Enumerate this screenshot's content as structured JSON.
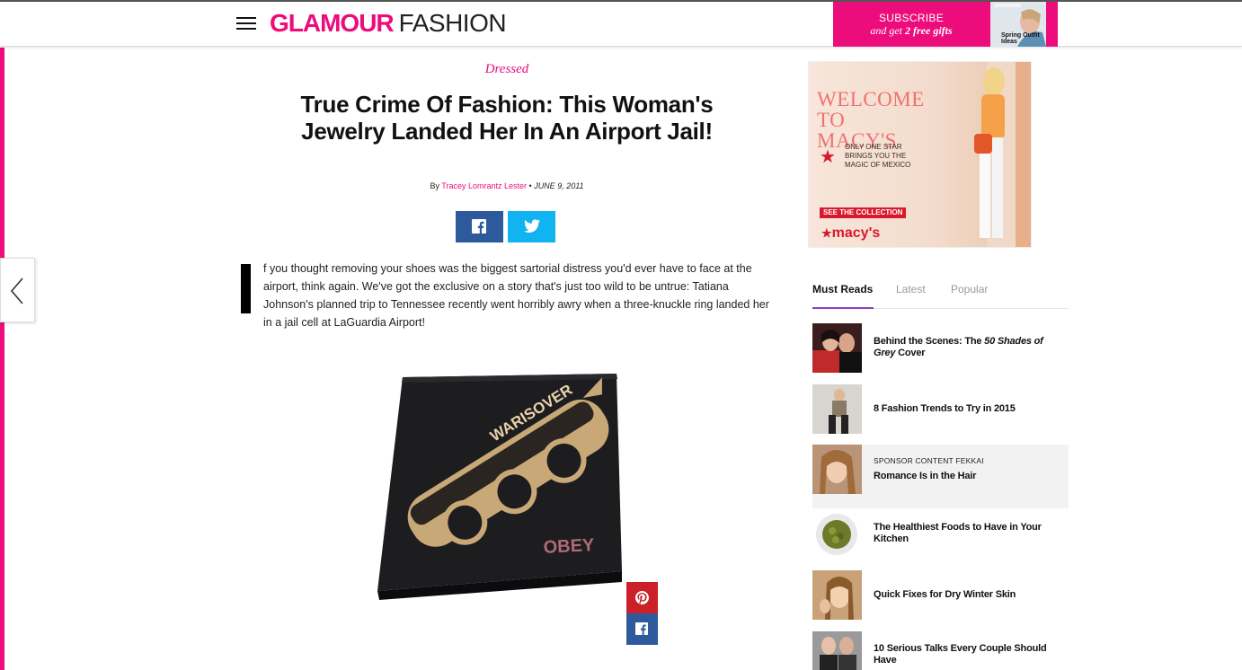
{
  "header": {
    "logo_glamour": "GLAMOUR",
    "logo_fashion": "FASHION",
    "subscribe_line1": "SUBSCRIBE",
    "subscribe_line2_a": "and get ",
    "subscribe_line2_b": "2 free gifts",
    "magazine_cover_text": "Spring Outfit Ideas"
  },
  "article": {
    "category": "Dressed",
    "title": "True Crime Of Fashion: This Woman's Jewelry Landed Her In An Airport Jail!",
    "by_prefix": "By",
    "author": "Tracey Lomrantz Lester",
    "separator": "•",
    "date": "June 9, 2011",
    "body": "f you thought removing your shoes was the biggest sartorial distress you'd ever have to face at the airport, think again. We've got the exclusive on a story that's just too wild to be untrue: Tatiana Johnson's planned trip to Tennessee recently went horribly awry when a three-knuckle ring landed her in a jail cell at LaGuardia Airport!",
    "image_ring_text": "WARISOVER",
    "image_box_text": "OBEY"
  },
  "ad": {
    "welcome": "WELCOME TO MACY'S",
    "tagline": "ONLY ONE STAR BRINGS YOU THE MAGIC OF MEXICO",
    "cta": "SEE THE COLLECTION",
    "brand": "macy's"
  },
  "sidebar": {
    "tabs": [
      {
        "label": "Must Reads"
      },
      {
        "label": "Latest"
      },
      {
        "label": "Popular"
      }
    ],
    "items": [
      {
        "title_pre": "Behind the Scenes: The ",
        "title_em": "50 Shades of Grey",
        "title_post": " Cover"
      },
      {
        "title": "8 Fashion Trends to Try in 2015"
      },
      {
        "label": "SPONSOR CONTENT  FEKKAI",
        "title": "Romance Is in the Hair"
      },
      {
        "title": "The Healthiest Foods to Have in Your Kitchen"
      },
      {
        "title": "Quick Fixes for Dry Winter Skin"
      },
      {
        "title": "10 Serious Talks Every Couple Should Have"
      }
    ]
  },
  "colors": {
    "brand_pink": "#ec0c7c",
    "facebook": "#2d5a9c",
    "twitter": "#11b3f0",
    "pinterest": "#cb2027",
    "tab_underline": "#8b3fbf"
  },
  "icons": [
    "menu-icon",
    "chevron-left-icon",
    "facebook-icon",
    "twitter-icon",
    "pinterest-icon",
    "star-icon"
  ]
}
